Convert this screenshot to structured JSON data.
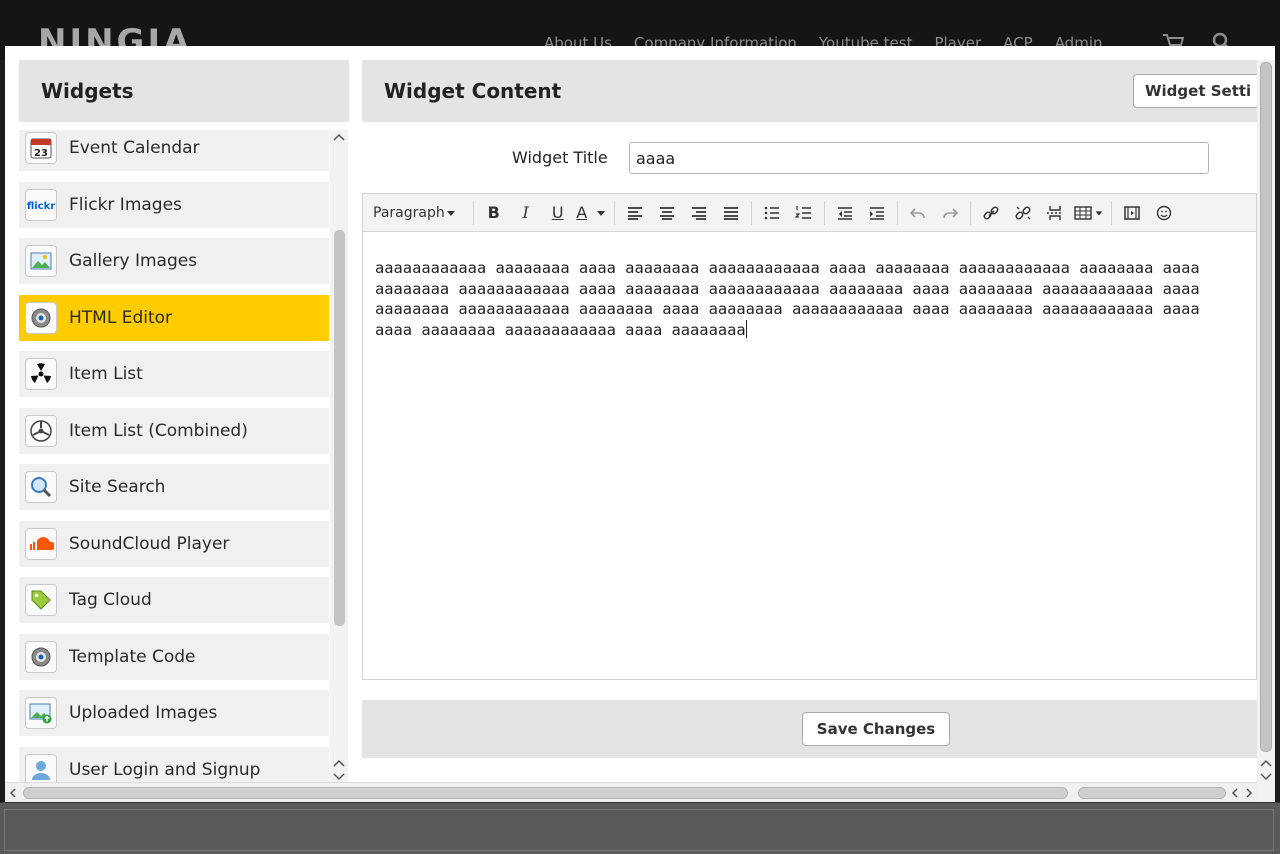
{
  "site": {
    "logo": "NINGJA",
    "nav": [
      "About Us",
      "Company Information",
      "Youtube test",
      "Player",
      "ACP",
      "Admin"
    ]
  },
  "widgets_panel": {
    "title": "Widgets",
    "items": [
      {
        "label": "Event Calendar",
        "icon": "calendar-icon",
        "active": false
      },
      {
        "label": "Flickr Images",
        "icon": "flickr-icon",
        "active": false
      },
      {
        "label": "Gallery Images",
        "icon": "gallery-icon",
        "active": false
      },
      {
        "label": "HTML Editor",
        "icon": "gear-icon",
        "active": true
      },
      {
        "label": "Item List",
        "icon": "radiation-icon",
        "active": false
      },
      {
        "label": "Item List (Combined)",
        "icon": "aperture-icon",
        "active": false
      },
      {
        "label": "Site Search",
        "icon": "magnifier-icon",
        "active": false
      },
      {
        "label": "SoundCloud Player",
        "icon": "soundcloud-icon",
        "active": false
      },
      {
        "label": "Tag Cloud",
        "icon": "tag-icon",
        "active": false
      },
      {
        "label": "Template Code",
        "icon": "gear-icon",
        "active": false
      },
      {
        "label": "Uploaded Images",
        "icon": "upload-image-icon",
        "active": false
      },
      {
        "label": "User Login and Signup",
        "icon": "user-icon",
        "active": false
      }
    ],
    "calendar_day": "23",
    "flickr_text": "flickr"
  },
  "content_panel": {
    "title": "Widget Content",
    "settings_button": "Widget Setti",
    "widget_title_label": "Widget Title",
    "widget_title_value": "aaaa",
    "format_dropdown": "Paragraph",
    "toolbar": {
      "bold": "B",
      "italic": "I",
      "underline": "U",
      "text_color": "A"
    },
    "editor_lines": [
      "aaaaaaaaaaaa aaaaaaaa aaaa aaaaaaaa aaaaaaaaaaaa aaaa aaaaaaaa aaaaaaaaaaaa aaaaaaaa aaaa",
      "aaaaaaaa aaaaaaaaaaaa aaaa aaaaaaaa aaaaaaaaaaaa aaaaaaaa aaaa aaaaaaaa aaaaaaaaaaaa aaaa",
      "aaaaaaaa aaaaaaaaaaaa aaaaaaaa aaaa aaaaaaaa aaaaaaaaaaaa aaaa aaaaaaaa aaaaaaaaaaaa aaaa",
      "aaaa aaaaaaaa aaaaaaaaaaaa aaaa aaaaaaaa"
    ],
    "save_button": "Save Changes"
  },
  "colors": {
    "active_item": "#ffcc00",
    "panel_header": "#e4e4e4",
    "page_bg": "#1b1b1b"
  }
}
